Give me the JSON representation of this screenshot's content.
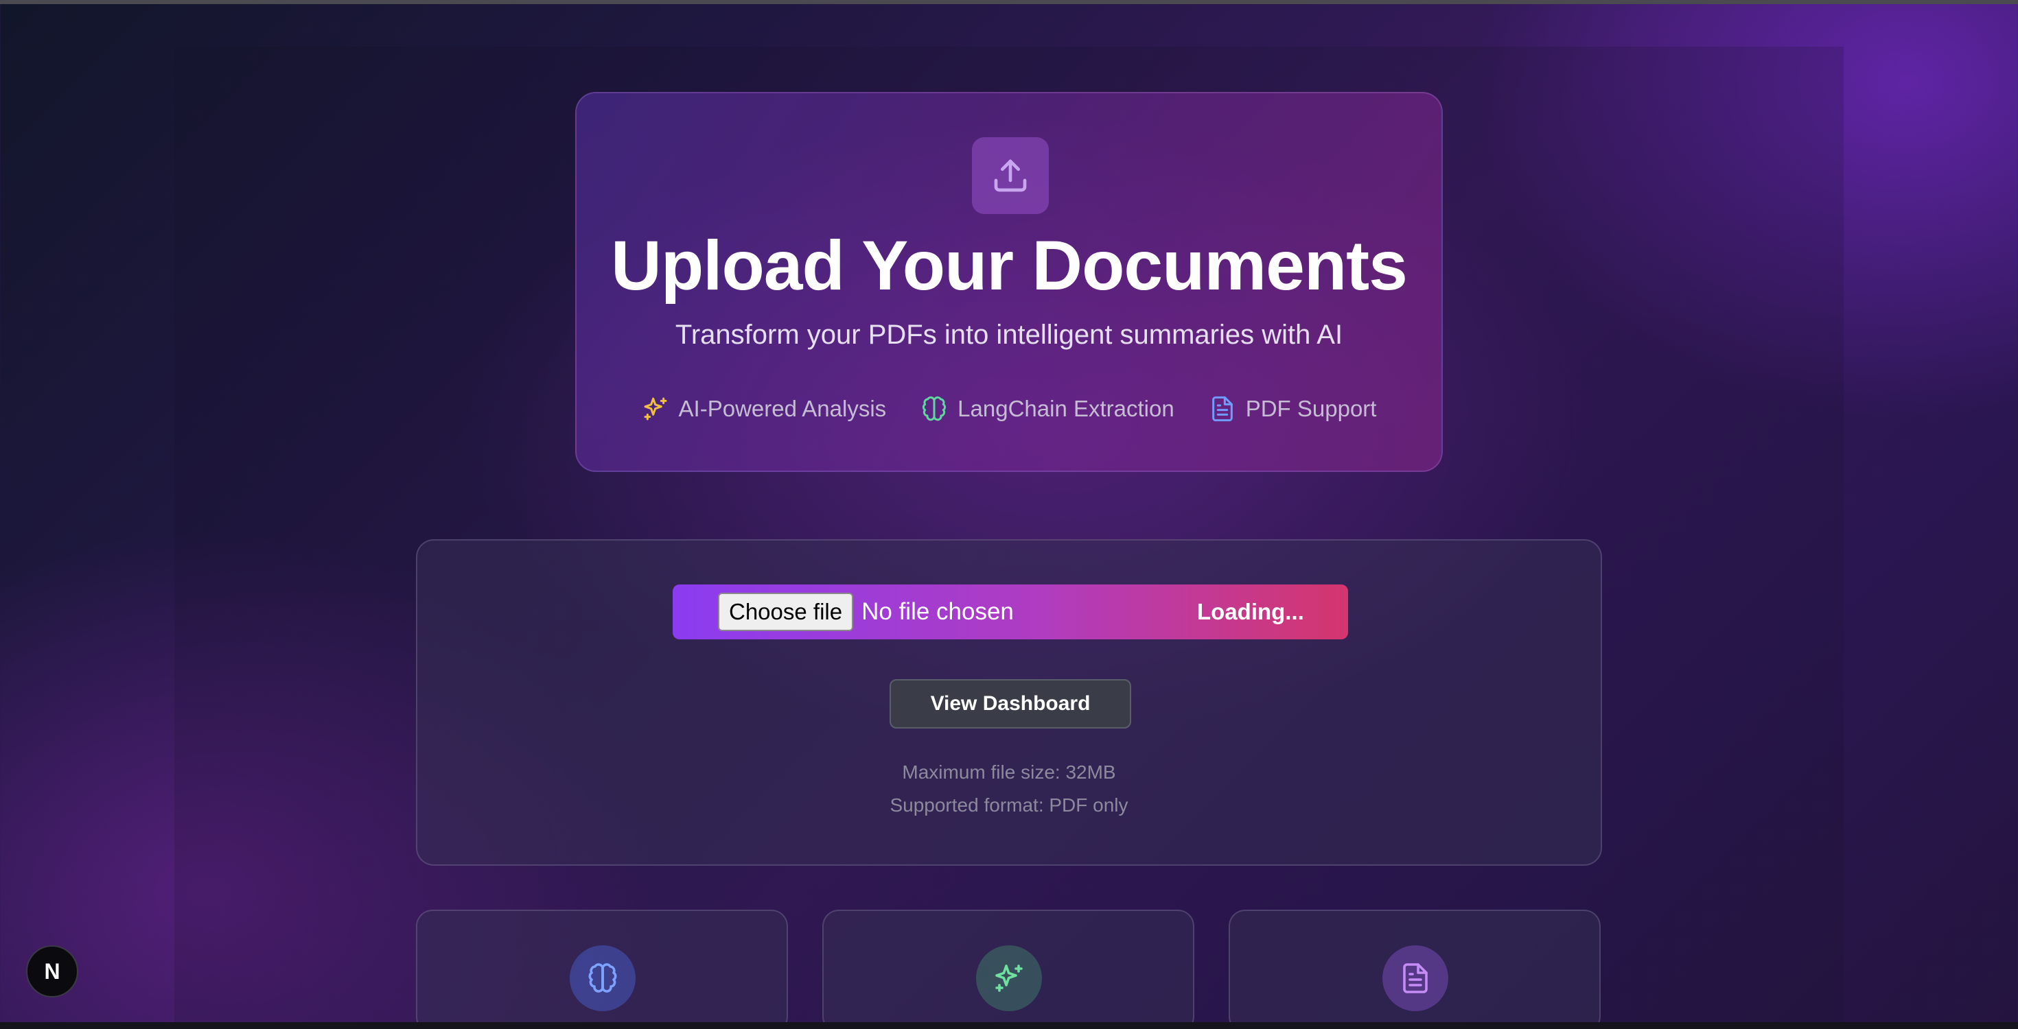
{
  "hero": {
    "icon": "upload-icon",
    "title": "Upload Your Documents",
    "subtitle": "Transform your PDFs into intelligent summaries with AI",
    "features": [
      {
        "icon": "sparkles-icon",
        "label": "AI-Powered Analysis",
        "color": "#f0c040"
      },
      {
        "icon": "brain-icon",
        "label": "LangChain Extraction",
        "color": "#5ed8a0"
      },
      {
        "icon": "file-text-icon",
        "label": "PDF Support",
        "color": "#6f9cff"
      }
    ]
  },
  "upload": {
    "choose_file_label": "Choose file",
    "no_file_text": "No file chosen",
    "status_text": "Loading...",
    "dashboard_button": "View Dashboard",
    "max_size_text": "Maximum file size: 32MB",
    "format_text": "Supported format: PDF only"
  },
  "feature_cards": [
    {
      "icon": "brain-icon",
      "color": "#7da2ff"
    },
    {
      "icon": "sparkles-icon",
      "color": "#6fe0a0"
    },
    {
      "icon": "file-text-icon",
      "color": "#c58cf5"
    }
  ],
  "next_badge": {
    "label": "N"
  }
}
